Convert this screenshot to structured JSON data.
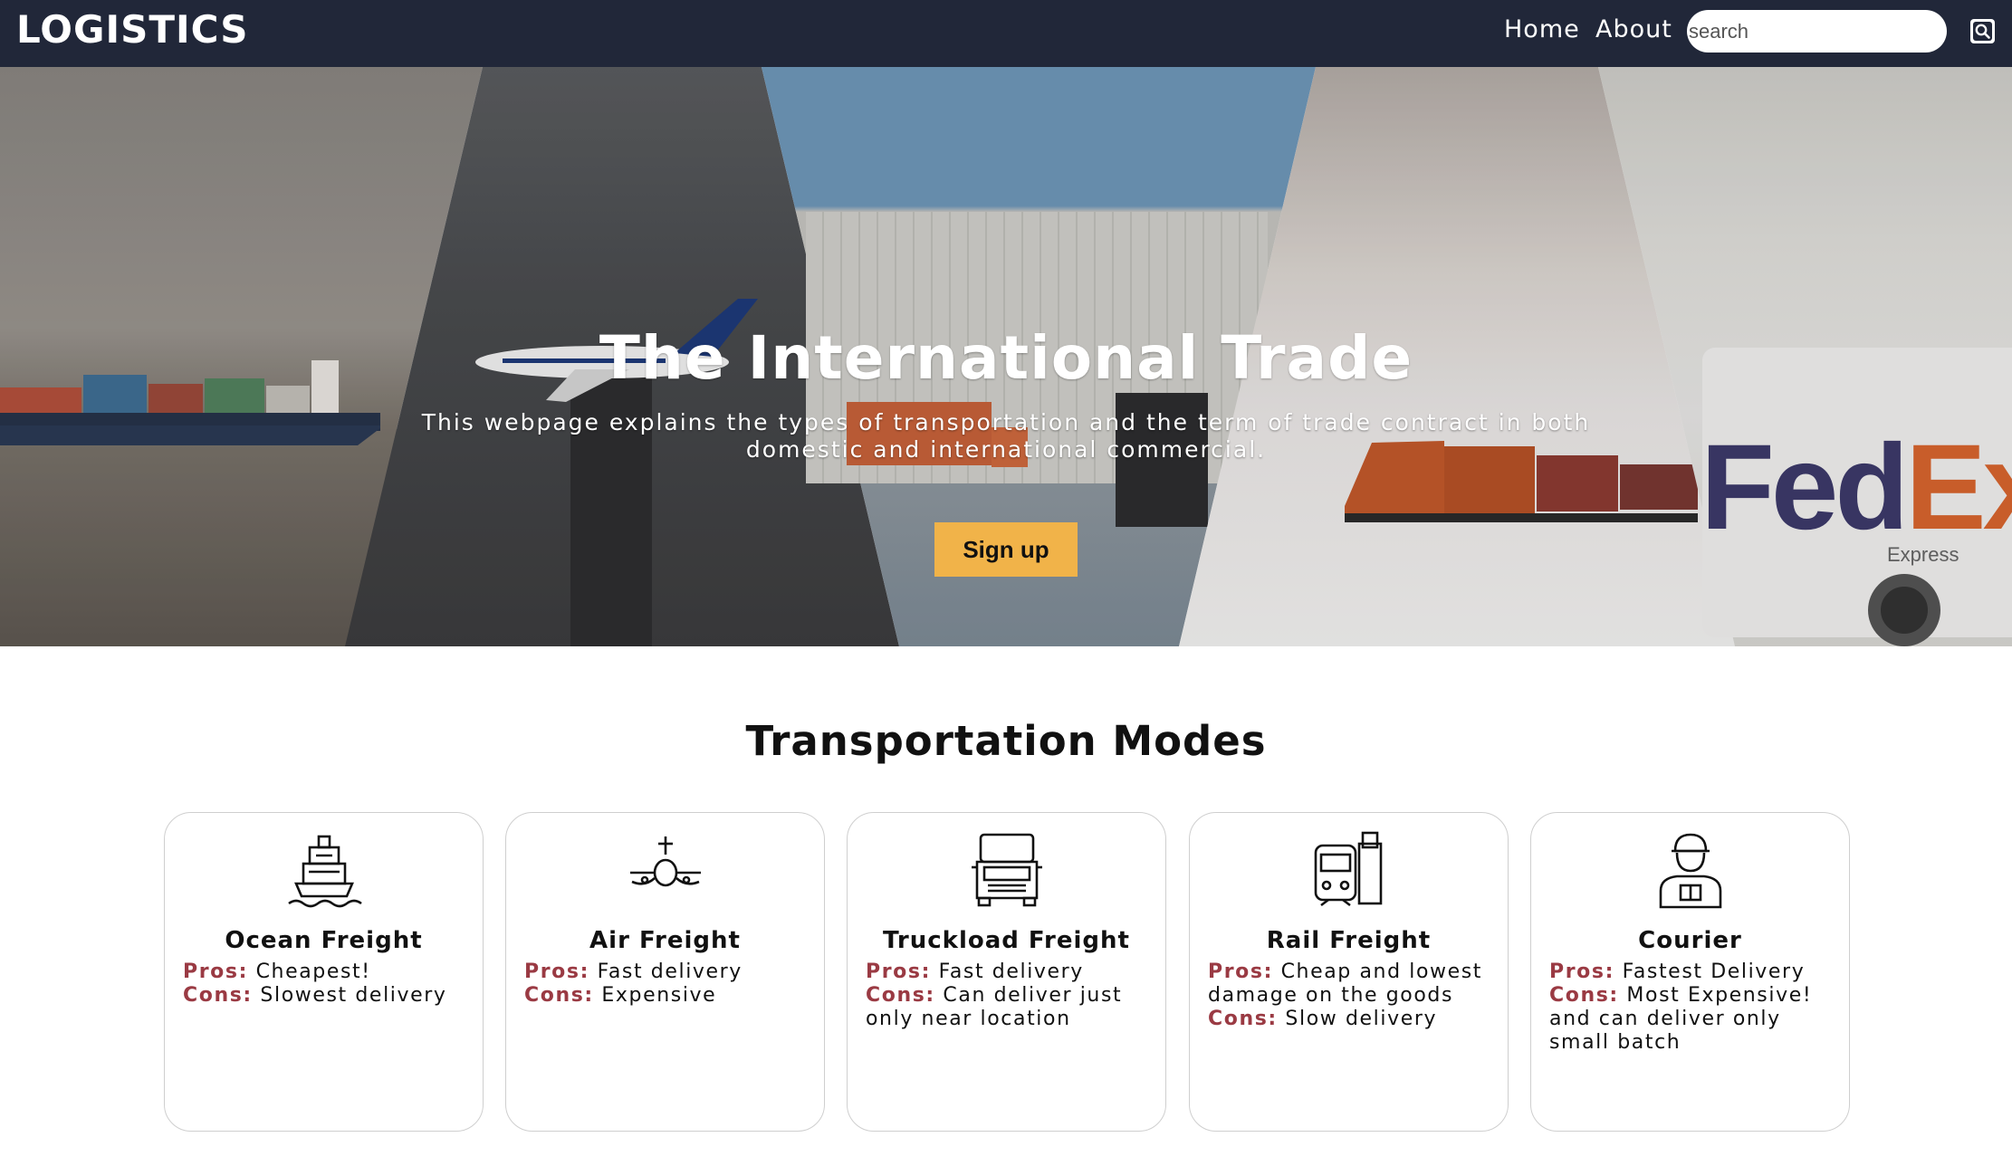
{
  "navbar": {
    "brand": "LOGISTICS",
    "links": [
      {
        "label": "Home"
      },
      {
        "label": "About"
      }
    ],
    "search": {
      "placeholder": "search",
      "value": ""
    },
    "search_icon": "search-icon"
  },
  "hero": {
    "title": "The International Trade",
    "subtitle": "This webpage explains the types of transportation and the term of trade contract in both domestic and international commercial.",
    "cta_label": "Sign up",
    "cta_color": "#f1b349",
    "background_images": [
      "cargo-ship",
      "city-airplane",
      "warehouse-truck",
      "snow-train",
      "fedex-van"
    ],
    "fedex_text": {
      "fed": "Fed",
      "ex": "Ex",
      "sub": "Express"
    }
  },
  "section": {
    "title": "Transportation Modes",
    "accent_color": "#9a3a43",
    "cards": [
      {
        "icon": "ship-icon",
        "title": "Ocean Freight",
        "pros_label": "Pros:",
        "pros": "Cheapest!",
        "cons_label": "Cons:",
        "cons": "Slowest delivery"
      },
      {
        "icon": "airplane-icon",
        "title": "Air Freight",
        "pros_label": "Pros:",
        "pros": "Fast delivery",
        "cons_label": "Cons:",
        "cons": "Expensive"
      },
      {
        "icon": "truck-icon",
        "title": "Truckload Freight",
        "pros_label": "Pros:",
        "pros": "Fast delivery",
        "cons_label": "Cons:",
        "cons": "Can deliver just only near location"
      },
      {
        "icon": "train-icon",
        "title": "Rail Freight",
        "pros_label": "Pros:",
        "pros": "Cheap and lowest damage on the goods",
        "cons_label": "Cons:",
        "cons": "Slow delivery"
      },
      {
        "icon": "courier-icon",
        "title": "Courier",
        "pros_label": "Pros:",
        "pros": "Fastest Delivery",
        "cons_label": "Cons:",
        "cons": "Most Expensive! and can deliver only small batch"
      }
    ]
  }
}
